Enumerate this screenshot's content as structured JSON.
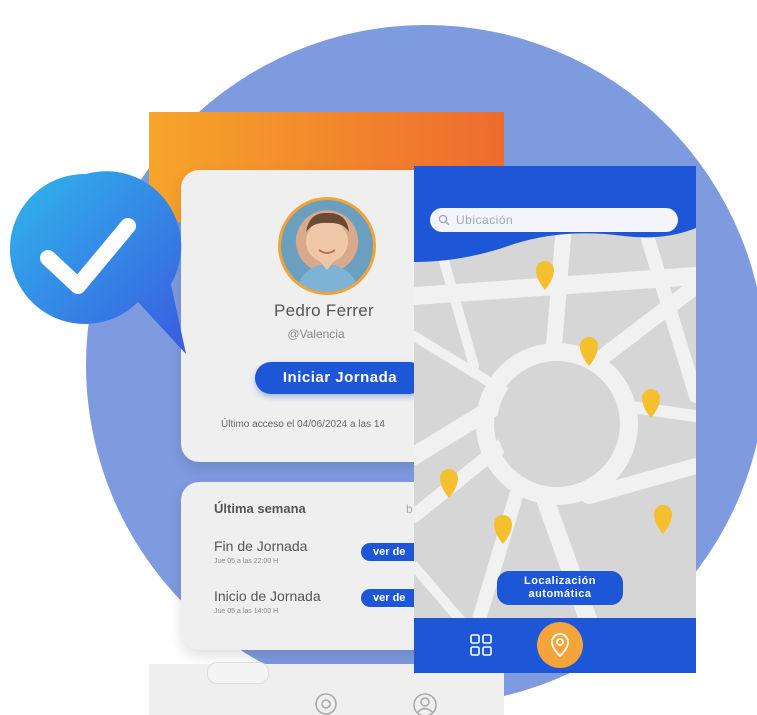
{
  "profile": {
    "name": "Pedro Ferrer",
    "location": "@Valencia",
    "start_button": "Iniciar Jornada",
    "last_access": "Último acceso el 04/06/2024 a las 14"
  },
  "week": {
    "title": "Última semana",
    "more": "b",
    "events": [
      {
        "title": "Fin de Jornada",
        "subtitle": "Jue 05 a las 22:00 H",
        "button": "ver de"
      },
      {
        "title": "Inicio de Jornada",
        "subtitle": "Jue 05 a las 14:00 H",
        "button": "ver de"
      }
    ]
  },
  "map": {
    "search_placeholder": "Ubicación",
    "auto_location_line1": "Localización",
    "auto_location_line2": "automática"
  },
  "colors": {
    "primary_blue": "#1e56d8",
    "accent_orange": "#f4a43a",
    "background_circle": "#7e9be0",
    "pin_yellow": "#f5c02e"
  },
  "icons": {
    "check": "check-icon",
    "search": "search-icon",
    "grid": "grid-icon",
    "location": "location-pin-icon",
    "home": "home-icon",
    "profile": "profile-icon"
  }
}
